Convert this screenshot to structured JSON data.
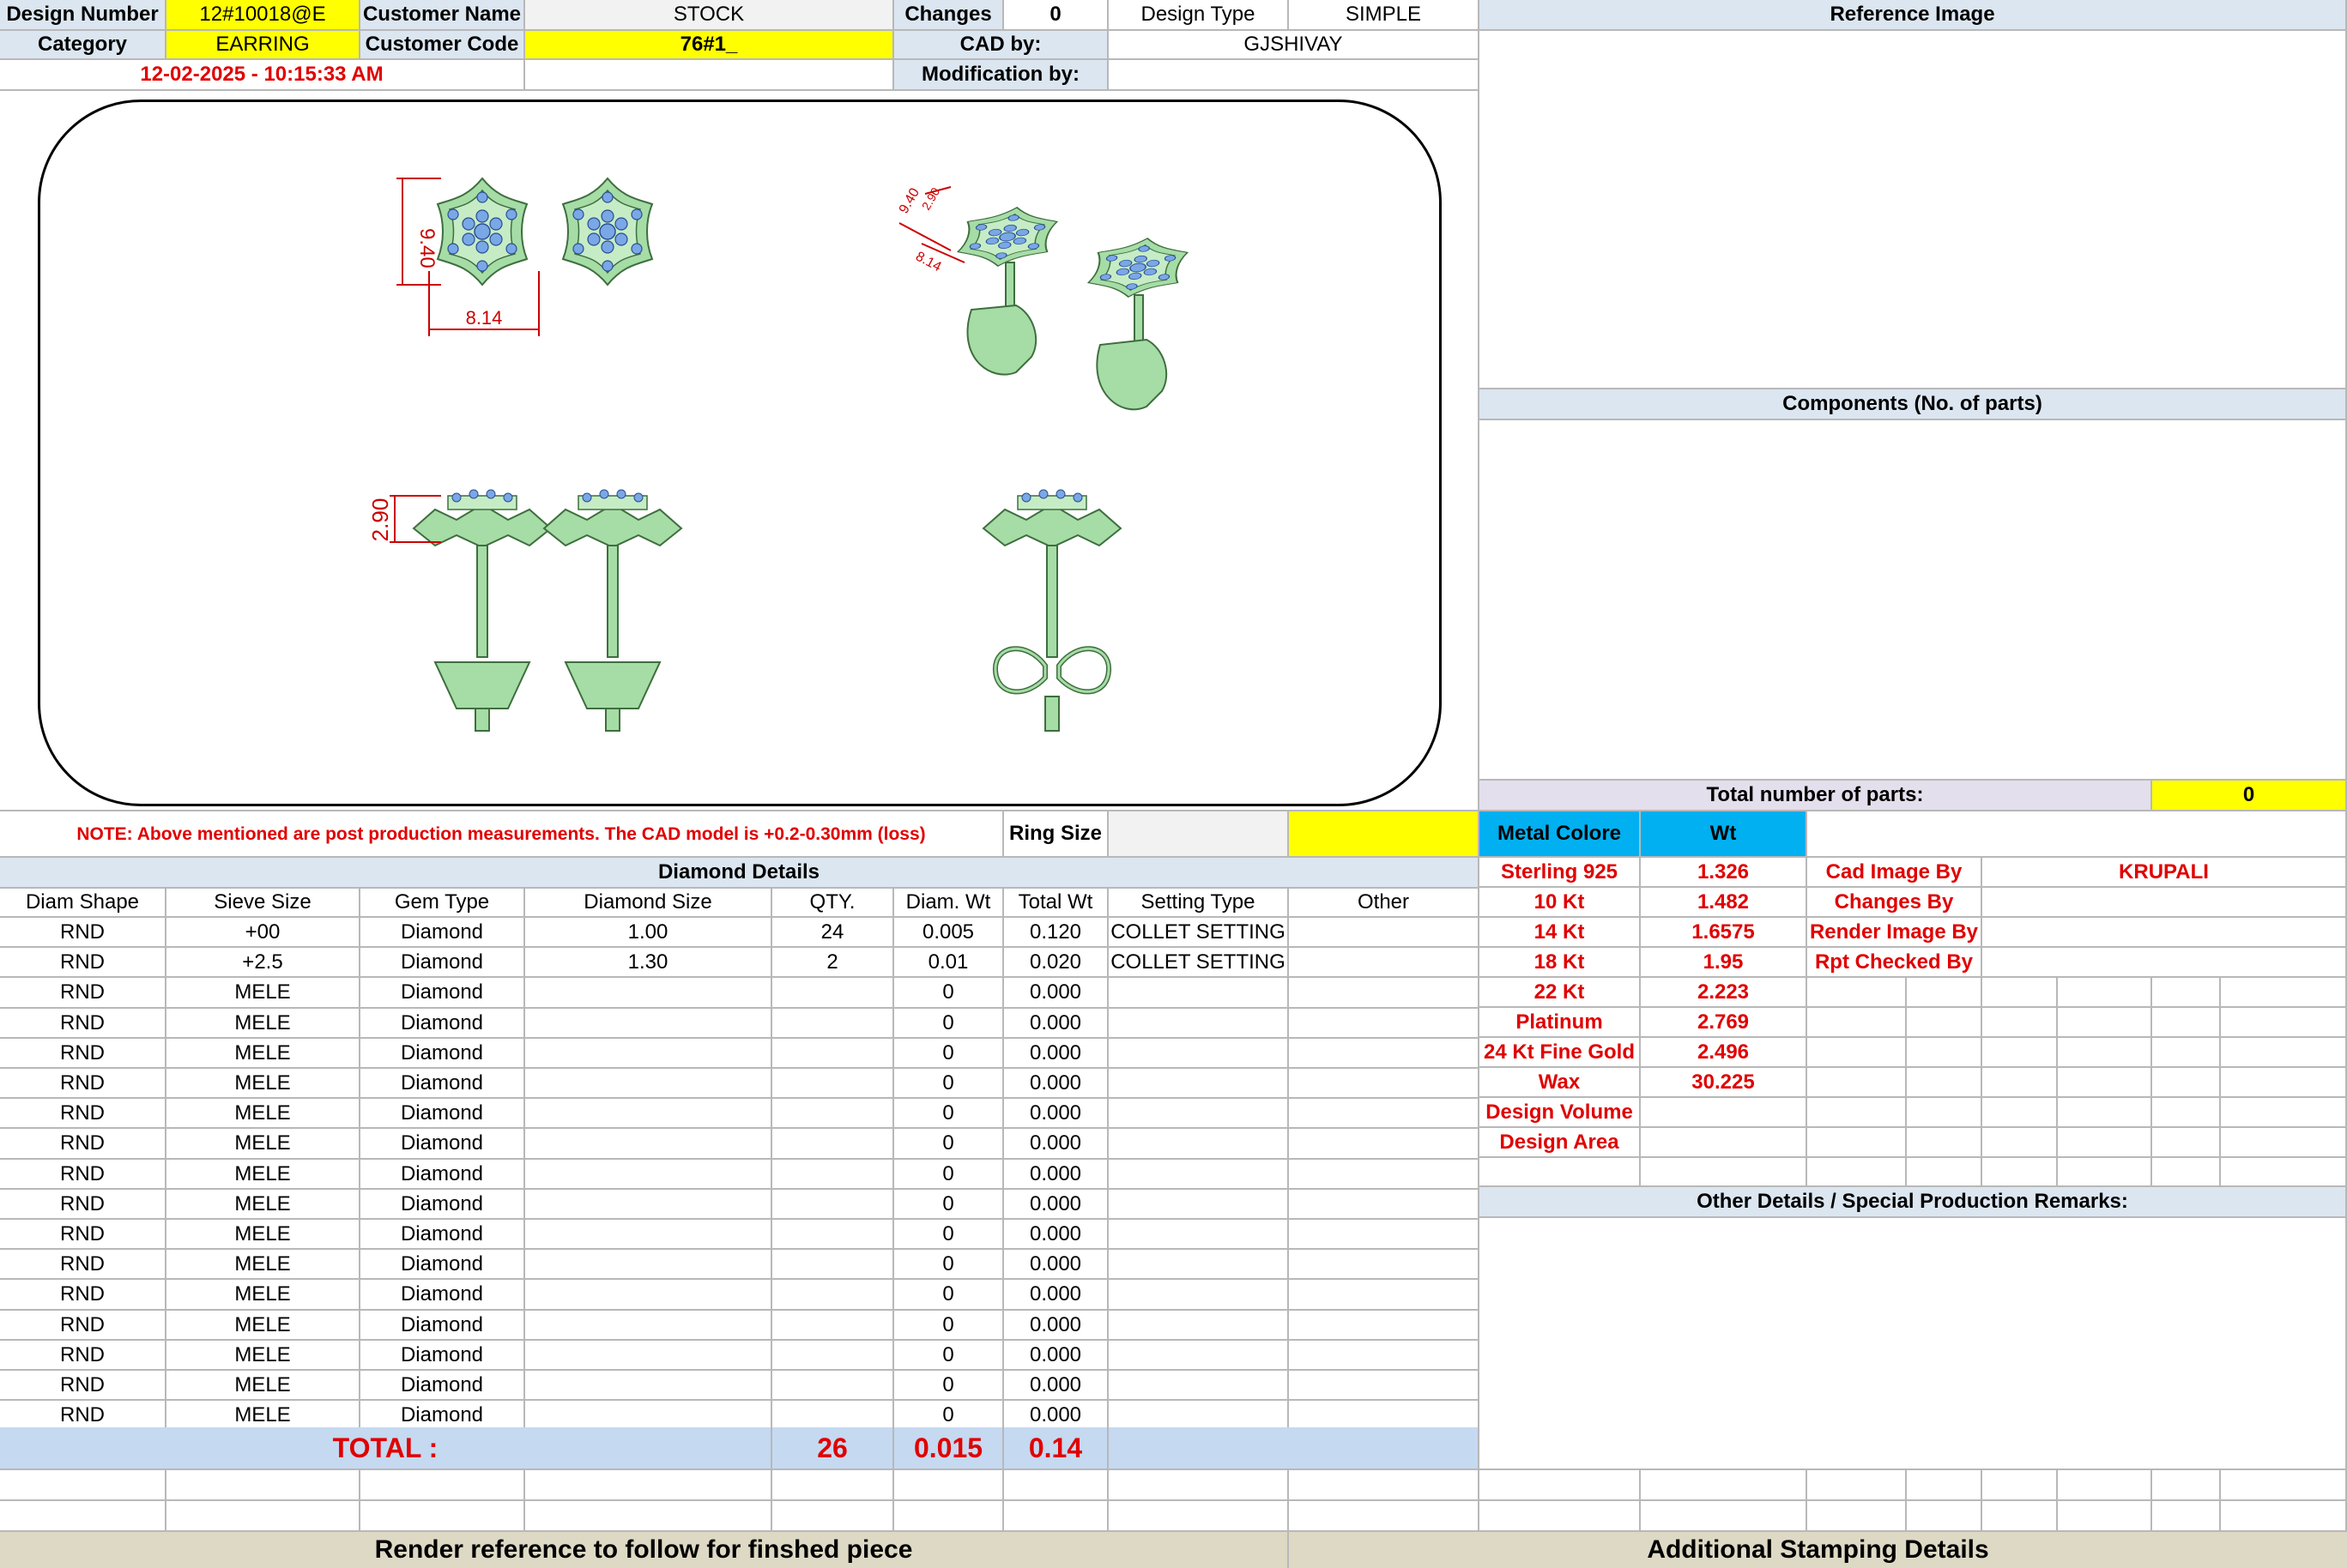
{
  "header": {
    "design_number_label": "Design Number",
    "design_number": "12#10018@E",
    "customer_name_label": "Customer Name",
    "customer_name": "STOCK",
    "changes_label": "Changes",
    "changes": "0",
    "design_type_label": "Design Type",
    "design_type": "SIMPLE",
    "reference_image_label": "Reference Image",
    "category_label": "Category",
    "category": "EARRING",
    "customer_code_label": "Customer Code",
    "customer_code": "76#1_",
    "cad_by_label": "CAD by:",
    "cad_by": "GJSHIVAY",
    "timestamp": "12-02-2025 - 10:15:33 AM",
    "modification_by_label": "Modification by:",
    "modification_by": ""
  },
  "drawing": {
    "dim_height": "9.40",
    "dim_width": "8.14",
    "dim_thickness": "2.90",
    "iso_dim_a": "9.40",
    "iso_dim_b": "2.90",
    "iso_dim_c": "8.14"
  },
  "right_panel": {
    "components_label": "Components (No. of parts)",
    "total_parts_label": "Total number of parts:",
    "total_parts": "0",
    "metal_colore_label": "Metal Colore",
    "wt_label": "Wt",
    "metals": [
      {
        "name": "Sterling 925",
        "wt": "1.326"
      },
      {
        "name": "10 Kt",
        "wt": "1.482"
      },
      {
        "name": "14 Kt",
        "wt": "1.6575"
      },
      {
        "name": "18 Kt",
        "wt": "1.95"
      },
      {
        "name": "22 Kt",
        "wt": "2.223"
      },
      {
        "name": "Platinum",
        "wt": "2.769"
      },
      {
        "name": "24 Kt Fine Gold",
        "wt": "2.496"
      },
      {
        "name": "Wax",
        "wt": "30.225"
      },
      {
        "name": "Design Volume",
        "wt": ""
      },
      {
        "name": "Design Area",
        "wt": ""
      }
    ],
    "roles": [
      {
        "label": "Cad Image By",
        "value": "KRUPALI"
      },
      {
        "label": "Changes By",
        "value": ""
      },
      {
        "label": "Render Image By",
        "value": ""
      },
      {
        "label": "Rpt Checked By",
        "value": ""
      }
    ],
    "other_details_label": "Other Details / Special Production Remarks:",
    "additional_stamping_label": "Additional Stamping Details"
  },
  "note": {
    "text": "NOTE: Above mentioned are post production measurements. The CAD model is +0.2-0.30mm (loss)",
    "ring_size_label": "Ring Size",
    "ring_size": ""
  },
  "diamond": {
    "title": "Diamond Details",
    "columns": [
      "Diam Shape",
      "Sieve Size",
      "Gem Type",
      "Diamond Size",
      "QTY.",
      "Diam. Wt",
      "Total Wt",
      "Setting Type",
      "Other"
    ],
    "rows": [
      [
        "RND",
        "+00",
        "Diamond",
        "1.00",
        "24",
        "0.005",
        "0.120",
        "COLLET SETTING",
        ""
      ],
      [
        "RND",
        "+2.5",
        "Diamond",
        "1.30",
        "2",
        "0.01",
        "0.020",
        "COLLET SETTING",
        ""
      ],
      [
        "RND",
        "MELE",
        "Diamond",
        "",
        "",
        "0",
        "0.000",
        "",
        ""
      ],
      [
        "RND",
        "MELE",
        "Diamond",
        "",
        "",
        "0",
        "0.000",
        "",
        ""
      ],
      [
        "RND",
        "MELE",
        "Diamond",
        "",
        "",
        "0",
        "0.000",
        "",
        ""
      ],
      [
        "RND",
        "MELE",
        "Diamond",
        "",
        "",
        "0",
        "0.000",
        "",
        ""
      ],
      [
        "RND",
        "MELE",
        "Diamond",
        "",
        "",
        "0",
        "0.000",
        "",
        ""
      ],
      [
        "RND",
        "MELE",
        "Diamond",
        "",
        "",
        "0",
        "0.000",
        "",
        ""
      ],
      [
        "RND",
        "MELE",
        "Diamond",
        "",
        "",
        "0",
        "0.000",
        "",
        ""
      ],
      [
        "RND",
        "MELE",
        "Diamond",
        "",
        "",
        "0",
        "0.000",
        "",
        ""
      ],
      [
        "RND",
        "MELE",
        "Diamond",
        "",
        "",
        "0",
        "0.000",
        "",
        ""
      ],
      [
        "RND",
        "MELE",
        "Diamond",
        "",
        "",
        "0",
        "0.000",
        "",
        ""
      ],
      [
        "RND",
        "MELE",
        "Diamond",
        "",
        "",
        "0",
        "0.000",
        "",
        ""
      ],
      [
        "RND",
        "MELE",
        "Diamond",
        "",
        "",
        "0",
        "0.000",
        "",
        ""
      ],
      [
        "RND",
        "MELE",
        "Diamond",
        "",
        "",
        "0",
        "0.000",
        "",
        ""
      ],
      [
        "RND",
        "MELE",
        "Diamond",
        "",
        "",
        "0",
        "0.000",
        "",
        ""
      ],
      [
        "RND",
        "MELE",
        "Diamond",
        "",
        "",
        "0",
        "0.000",
        "",
        ""
      ]
    ],
    "total_label": "TOTAL :",
    "total_qty": "26",
    "total_diam_wt": "0.015",
    "total_wt": "0.14"
  },
  "footer": {
    "render_reference_label": "Render reference to follow for finshed piece"
  },
  "colors": {
    "header_blue": "#dce6f1",
    "highlight_yellow": "#ffff00",
    "metal_cyan": "#00b0f0",
    "label_red": "#e00000",
    "total_blue": "#c5d9f1",
    "footer_tan": "#ddd9c4",
    "parts_lavender": "#e4dfec",
    "model_green": "#9fdc9f",
    "stone_blue": "#7aa7e6"
  }
}
